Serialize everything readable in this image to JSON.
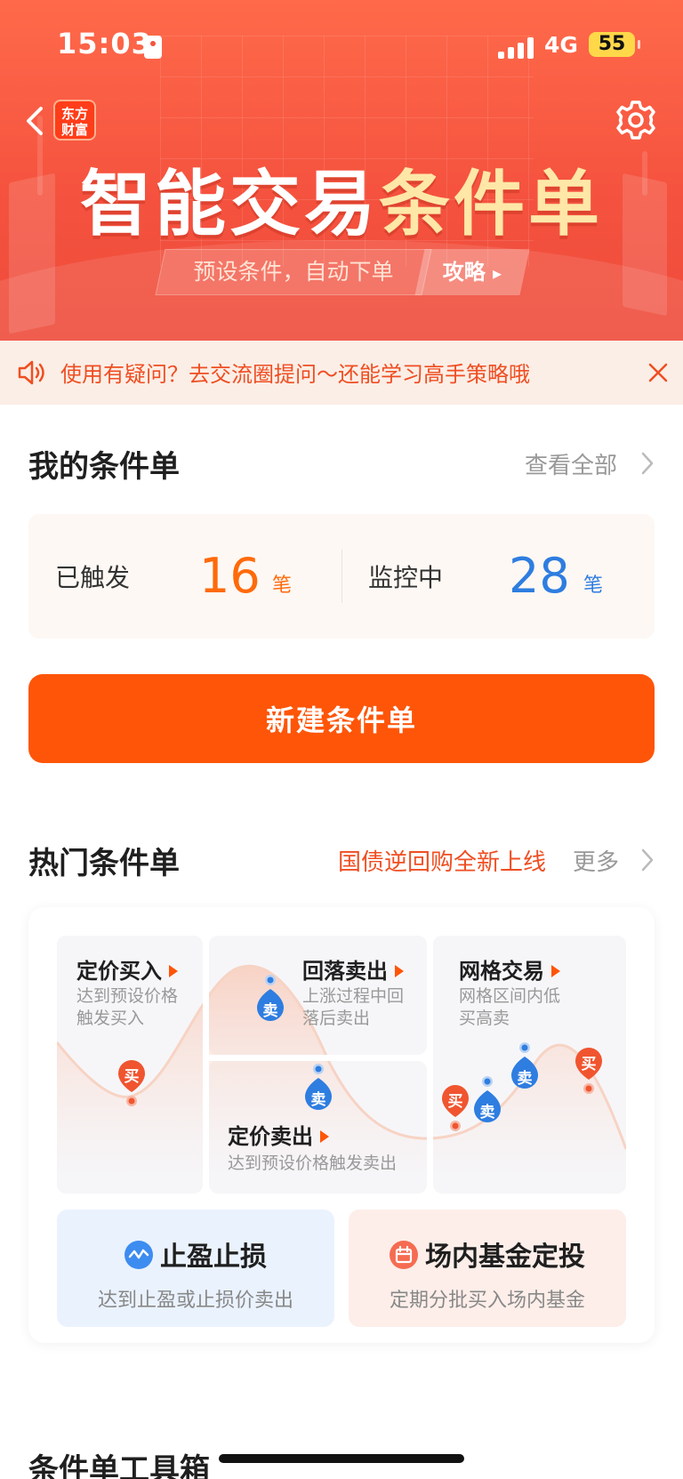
{
  "status_bar": {
    "time": "15:03",
    "network": "4G",
    "battery": "55"
  },
  "header": {
    "logo_line1": "东方",
    "logo_line2": "财富",
    "title_part1": "智能交易",
    "title_part2": "条件单",
    "subtitle": "预设条件，自动下单",
    "guide_label": "攻略"
  },
  "notice": {
    "text": "使用有疑问？去交流圈提问～还能学习高手策略哦"
  },
  "my_orders": {
    "title": "我的条件单",
    "view_all": "查看全部",
    "triggered_label": "已触发",
    "triggered_count": "16",
    "triggered_unit": "笔",
    "monitoring_label": "监控中",
    "monitoring_count": "28",
    "monitoring_unit": "笔"
  },
  "new_order_button": "新建条件单",
  "hot_orders": {
    "title": "热门条件单",
    "promo": "国债逆回购全新上线",
    "more": "更多",
    "items": [
      {
        "title": "定价买入",
        "desc": "达到预设价格\n触发买入"
      },
      {
        "title": "回落卖出",
        "desc": "上涨过程中回\n落后卖出"
      },
      {
        "title": "网格交易",
        "desc": "网格区间内低\n买高卖"
      },
      {
        "title": "定价卖出",
        "desc": "达到预设价格触发卖出"
      }
    ],
    "pin_buy": "买",
    "pin_sell": "卖",
    "tools": [
      {
        "title": "止盈止损",
        "desc": "达到止盈或止损价卖出"
      },
      {
        "title": "场内基金定投",
        "desc": "定期分批买入场内基金"
      }
    ]
  },
  "toolbox": {
    "title": "条件单工具箱"
  },
  "colors": {
    "accent": "#ff5508",
    "hero": "#f5533f",
    "blue": "#2e7de0",
    "notice_bg": "#fbeee6"
  }
}
